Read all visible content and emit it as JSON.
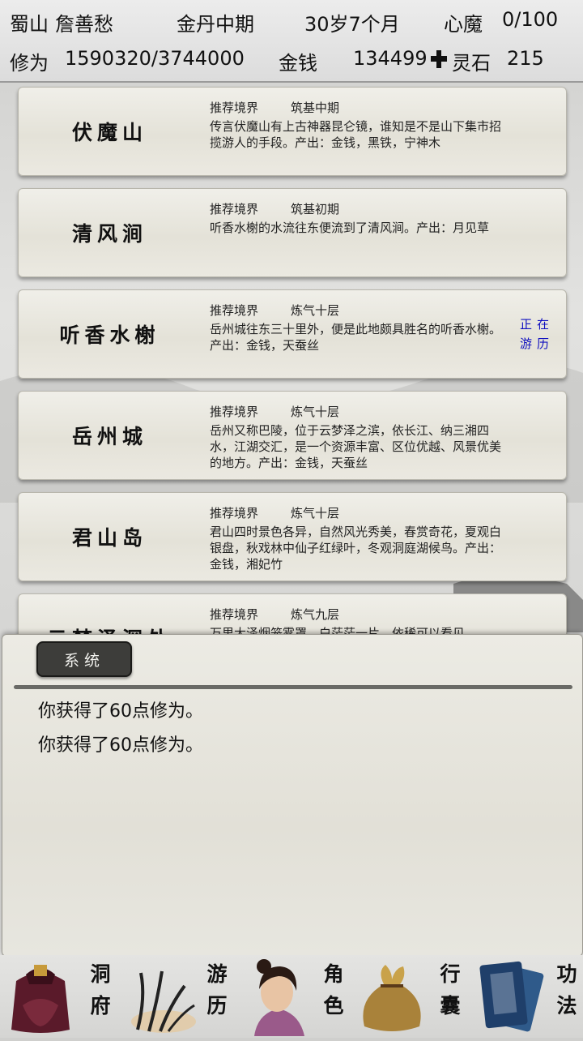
{
  "status": {
    "sect": "蜀山",
    "name": "詹善愁",
    "realm": "金丹中期",
    "age": "30岁7个月",
    "heart_demon_label": "心魔",
    "heart_demon_value": "0/100",
    "cultivation_label": "修为",
    "cultivation_value": "1590320/3744000",
    "money_label": "金钱",
    "money_value": "134499",
    "add_icon": "plus-icon",
    "spirit_stone_label": "灵石",
    "spirit_stone_value": "215"
  },
  "locations": [
    {
      "name": "伏魔山",
      "rec_label": "推荐境界",
      "rec_value": "筑基中期",
      "desc": "传言伏魔山有上古神器昆仑镜，谁知是不是山下集市招揽游人的手段。产出：金钱，黑铁，宁神木",
      "active": ""
    },
    {
      "name": "清风涧",
      "rec_label": "推荐境界",
      "rec_value": "筑基初期",
      "desc": "听香水榭的水流往东便流到了清风涧。产出：月见草",
      "active": ""
    },
    {
      "name": "听香水榭",
      "rec_label": "推荐境界",
      "rec_value": "炼气十层",
      "desc": "岳州城往东三十里外，便是此地颇具胜名的听香水榭。产出：金钱，天蚕丝",
      "active": "正在游历"
    },
    {
      "name": "岳州城",
      "rec_label": "推荐境界",
      "rec_value": "炼气十层",
      "desc": "岳州又称巴陵，位于云梦泽之滨，依长江、纳三湘四水，江湖交汇，是一个资源丰富、区位优越、风景优美的地方。产出：金钱，天蚕丝",
      "active": ""
    },
    {
      "name": "君山岛",
      "rec_label": "推荐境界",
      "rec_value": "炼气十层",
      "desc": "君山四时景色各异，自然风光秀美，春赏奇花，夏观白银盘，秋戏林中仙子红绿叶，冬观洞庭湖候鸟。产出：金钱，湘妃竹",
      "active": ""
    },
    {
      "name": "云梦泽深处",
      "rec_label": "推荐境界",
      "rec_value": "炼气九层",
      "desc": "万里大泽烟笼雾罩，白茫茫一片，依稀可以看见",
      "active": ""
    }
  ],
  "panel": {
    "tab_label": "系统",
    "messages": [
      "你获得了60点修为。",
      "你获得了60点修为。"
    ]
  },
  "nav": {
    "items": [
      {
        "label": "洞府",
        "icon": "cave-treasure-icon"
      },
      {
        "label": "游历",
        "icon": "grass-travel-icon"
      },
      {
        "label": "角色",
        "icon": "character-portrait-icon"
      },
      {
        "label": "行囊",
        "icon": "bag-icon"
      },
      {
        "label": "功法",
        "icon": "scroll-books-icon"
      }
    ]
  },
  "colors": {
    "active_text": "#1010c0",
    "tab_bg": "#3d3d3a"
  }
}
